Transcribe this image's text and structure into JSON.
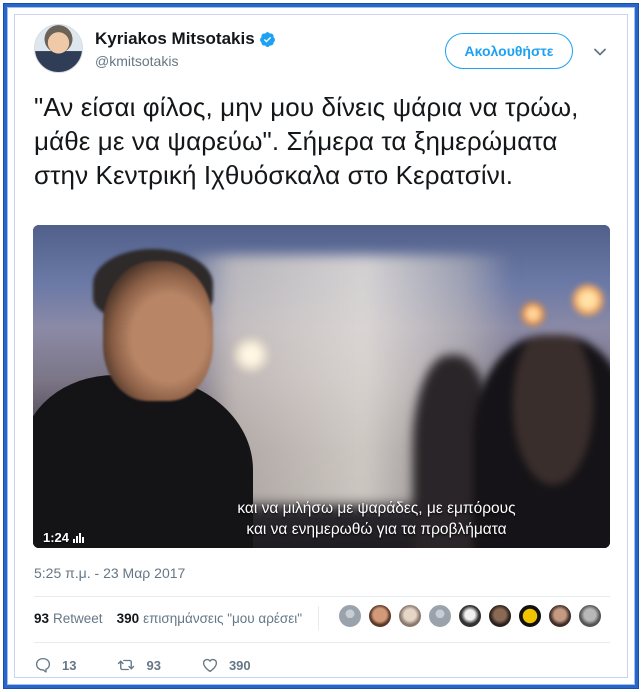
{
  "author": {
    "display_name": "Kyriakos Mitsotakis",
    "handle": "@kmitsotakis",
    "verified": true
  },
  "follow_button_label": "Ακολουθήστε",
  "tweet": {
    "text": "\"Αν είσαι φίλος, μην μου δίνεις ψάρια να τρώω, μάθε με να ψαρεύω\". Σήμερα τα ξημερώματα στην Κεντρική Ιχθυόσκαλα στο Κερατσίνι.",
    "timestamp": "5:25 π.μ. - 23 Μαρ 2017"
  },
  "video": {
    "subtitle_line1": "και να μιλήσω με ψαράδες, με εμπόρους",
    "subtitle_line2": "και να ενημερωθώ για τα προβλήματα",
    "duration": "1:24"
  },
  "stats": {
    "retweets_count": "93",
    "retweets_label": "Retweet",
    "likes_count": "390",
    "likes_label": "επισημάνσεις \"μου αρέσει\""
  },
  "actions": {
    "replies": "13",
    "retweets": "93",
    "likes": "390"
  },
  "colors": {
    "accent": "#1da1f2",
    "frame": "#2a66c8",
    "muted_text": "#657786"
  },
  "icons": [
    "verified-badge-icon",
    "chevron-down-icon",
    "reply-icon",
    "retweet-icon",
    "like-icon",
    "volume-bars-icon"
  ]
}
